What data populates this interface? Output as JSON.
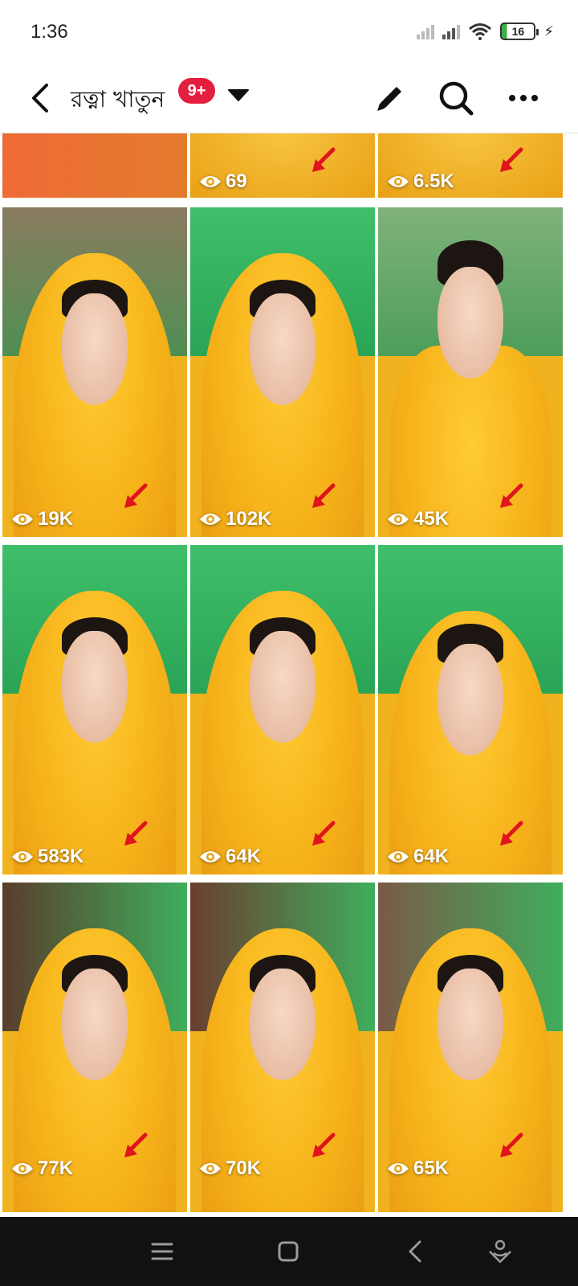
{
  "status_bar": {
    "time": "1:36",
    "battery": "16"
  },
  "header": {
    "title": "রত্না খাতুন",
    "badge": "9+"
  },
  "icons": {
    "back": "chevron-left-icon",
    "caret": "caret-down-icon",
    "edit": "pencil-icon",
    "search": "search-icon",
    "more": "more-horizontal-icon",
    "views": "eye-icon",
    "arrow": "red-arrow-icon"
  },
  "colors": {
    "badge": "#e41e3f",
    "scarf": "#f6b21a",
    "wall": "#2aa455"
  },
  "grid": {
    "items": [
      {
        "views": ""
      },
      {
        "views": "69"
      },
      {
        "views": "6.5K"
      },
      {
        "views": "19K"
      },
      {
        "views": "102K"
      },
      {
        "views": "45K"
      },
      {
        "views": "583K"
      },
      {
        "views": "64K"
      },
      {
        "views": "64K"
      },
      {
        "views": "77K"
      },
      {
        "views": "70K"
      },
      {
        "views": "65K"
      }
    ]
  },
  "navbar": {
    "items": [
      "menu-icon",
      "home-square-icon",
      "back-triangle-icon",
      "assistant-icon"
    ]
  }
}
